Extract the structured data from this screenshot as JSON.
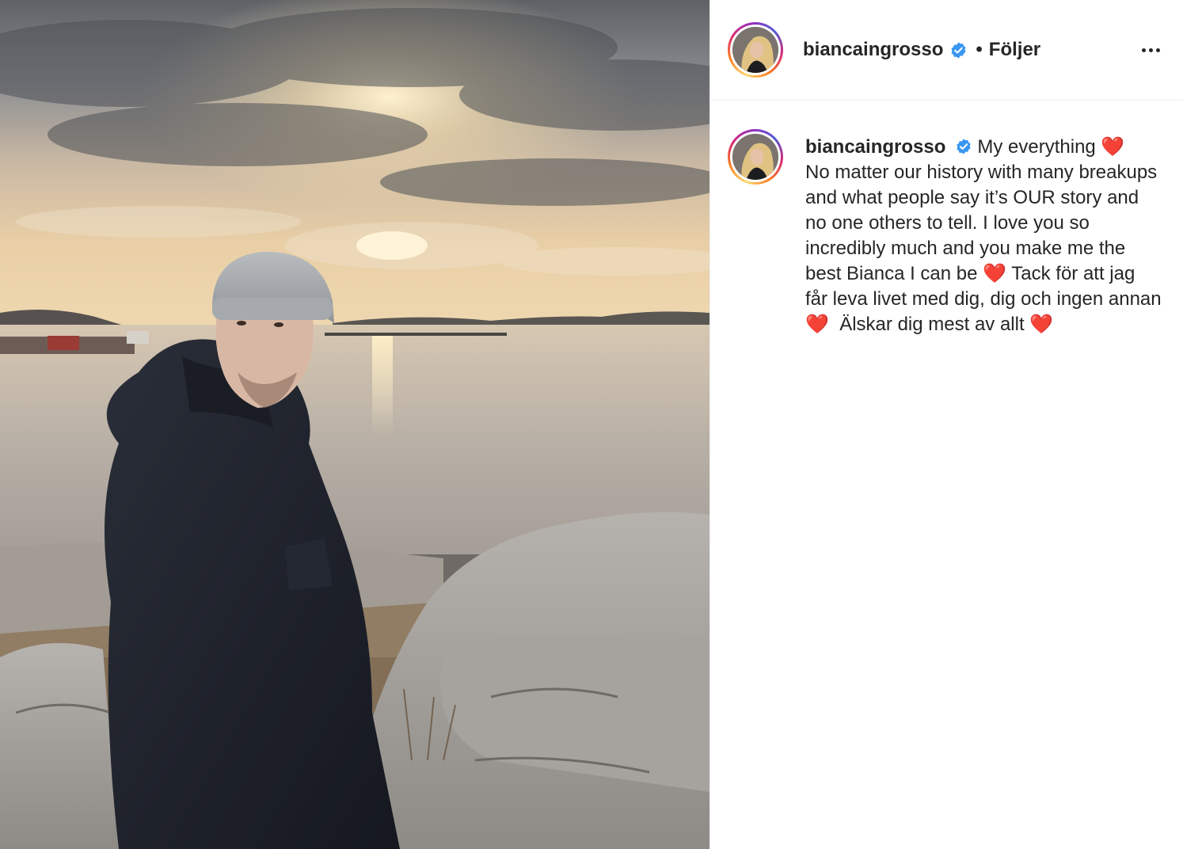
{
  "post": {
    "author": {
      "username": "biancaingrosso",
      "verified": true,
      "follow_state": "Följer",
      "separator": "•"
    },
    "caption": {
      "text": "My everything ❤️\nNo matter our history with many breakups and what people say it’s OUR story and no one others to tell. I love you so incredibly much and you make me the best Bianca I can be ❤️ Tack för att jag får leva livet med dig, dig och ingen annan ❤️  Älskar dig mest av allt ❤️"
    },
    "more_icon": "more-options-icon"
  },
  "colors": {
    "verified_badge": "#3897f0",
    "text": "#262626",
    "divider": "#efefef"
  }
}
